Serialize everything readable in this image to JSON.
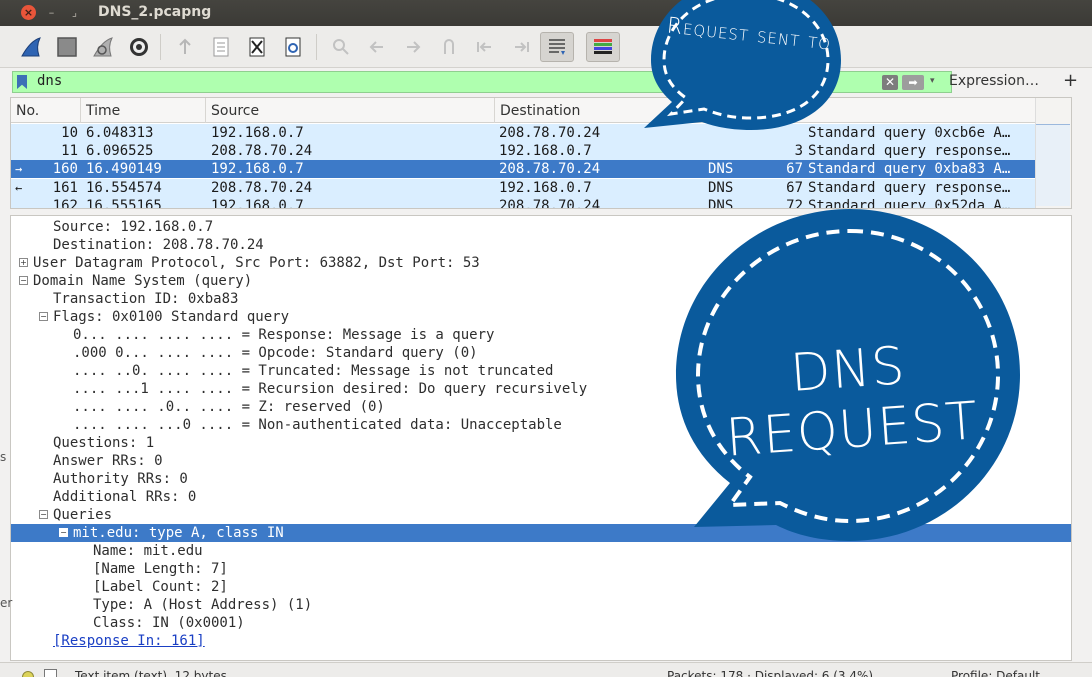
{
  "window": {
    "title": "DNS_2.pcapng",
    "close_glyph": "×",
    "min_glyph": "–",
    "max_glyph": "⌟"
  },
  "toolbar": {
    "icons": [
      "shark-fin-start-icon",
      "stop-square-icon",
      "restart-fin-icon",
      "options-gear-icon",
      "open-file-icon",
      "save-file-icon",
      "close-file-icon",
      "reload-file-icon",
      "find-packet-icon",
      "go-back-icon",
      "go-forward-icon",
      "go-to-packet-icon",
      "first-packet-icon",
      "last-packet-icon",
      "autoscroll-icon",
      "colorize-icon"
    ]
  },
  "filter": {
    "value": "dns",
    "clear_glyph": "✕",
    "apply_glyph": "➡",
    "dropdown_glyph": "▾",
    "expression_label": "Expression…",
    "add_label": "+"
  },
  "packet_list": {
    "columns": [
      "No.",
      "Time",
      "Source",
      "Destination"
    ],
    "rows": [
      {
        "no": "10",
        "time": "6.048313",
        "source": "192.168.0.7",
        "destination": "208.78.70.24",
        "protocol": "",
        "length": "",
        "info": "Standard query 0xcb6e A…",
        "selected": false
      },
      {
        "no": "11",
        "time": "6.096525",
        "source": "208.78.70.24",
        "destination": "192.168.0.7",
        "protocol": "",
        "length": "3",
        "info": "Standard query response…",
        "selected": false
      },
      {
        "no": "160",
        "time": "16.490149",
        "source": "192.168.0.7",
        "destination": "208.78.70.24",
        "protocol": "DNS",
        "length": "67",
        "info": "Standard query 0xba83 A…",
        "selected": true
      },
      {
        "no": "161",
        "time": "16.554574",
        "source": "208.78.70.24",
        "destination": "192.168.0.7",
        "protocol": "DNS",
        "length": "67",
        "info": "Standard query response…",
        "selected": false
      },
      {
        "no": "162",
        "time": "16.555165",
        "source": "192.168.0.7",
        "destination": "208.78.70.24",
        "protocol": "DNS",
        "length": "72",
        "info": "Standard query 0x52da A…",
        "selected": false
      }
    ]
  },
  "details": [
    {
      "text": "Source: 192.168.0.7",
      "expander": ""
    },
    {
      "text": "Destination: 208.78.70.24",
      "expander": ""
    },
    {
      "text": "User Datagram Protocol, Src Port: 63882, Dst Port: 53",
      "expander": "+"
    },
    {
      "text": "Domain Name System (query)",
      "expander": "−"
    },
    {
      "text": "Transaction ID: 0xba83",
      "expander": ""
    },
    {
      "text": "Flags: 0x0100 Standard query",
      "expander": "−"
    },
    {
      "text": "0... .... .... .... = Response: Message is a query",
      "expander": ""
    },
    {
      "text": ".000 0... .... .... = Opcode: Standard query (0)",
      "expander": ""
    },
    {
      "text": ".... ..0. .... .... = Truncated: Message is not truncated",
      "expander": ""
    },
    {
      "text": ".... ...1 .... .... = Recursion desired: Do query recursively",
      "expander": ""
    },
    {
      "text": ".... .... .0.. .... = Z: reserved (0)",
      "expander": ""
    },
    {
      "text": ".... .... ...0 .... = Non-authenticated data: Unacceptable",
      "expander": ""
    },
    {
      "text": "Questions: 1",
      "expander": ""
    },
    {
      "text": "Answer RRs: 0",
      "expander": ""
    },
    {
      "text": "Authority RRs: 0",
      "expander": ""
    },
    {
      "text": "Additional RRs: 0",
      "expander": ""
    },
    {
      "text": "Queries",
      "expander": "−"
    },
    {
      "text": "mit.edu: type A, class IN",
      "expander": "−"
    },
    {
      "text": "Name: mit.edu",
      "expander": ""
    },
    {
      "text": "[Name Length: 7]",
      "expander": ""
    },
    {
      "text": "[Label Count: 2]",
      "expander": ""
    },
    {
      "text": "Type: A (Host Address) (1)",
      "expander": ""
    },
    {
      "text": "Class: IN (0x0001)",
      "expander": ""
    },
    {
      "text": "[Response In: 161]",
      "expander": ""
    }
  ],
  "status": {
    "item_text": "Text item (text), 12 bytes",
    "packets_text": "Packets: 178 · Displayed: 6 (3.4%)",
    "profile_text": "Profile: Default"
  },
  "left_edge": {
    "s": "s",
    "er": "er"
  },
  "annotations": {
    "small_bubble_text": "Request sent to",
    "large_bubble_text": "DNS REQUEST",
    "bubble_color": "#0a5a9c"
  },
  "colors": {
    "selected_row": "#3d7ac8",
    "row_bg": "#daeeff",
    "filter_ok": "#afffaf"
  }
}
